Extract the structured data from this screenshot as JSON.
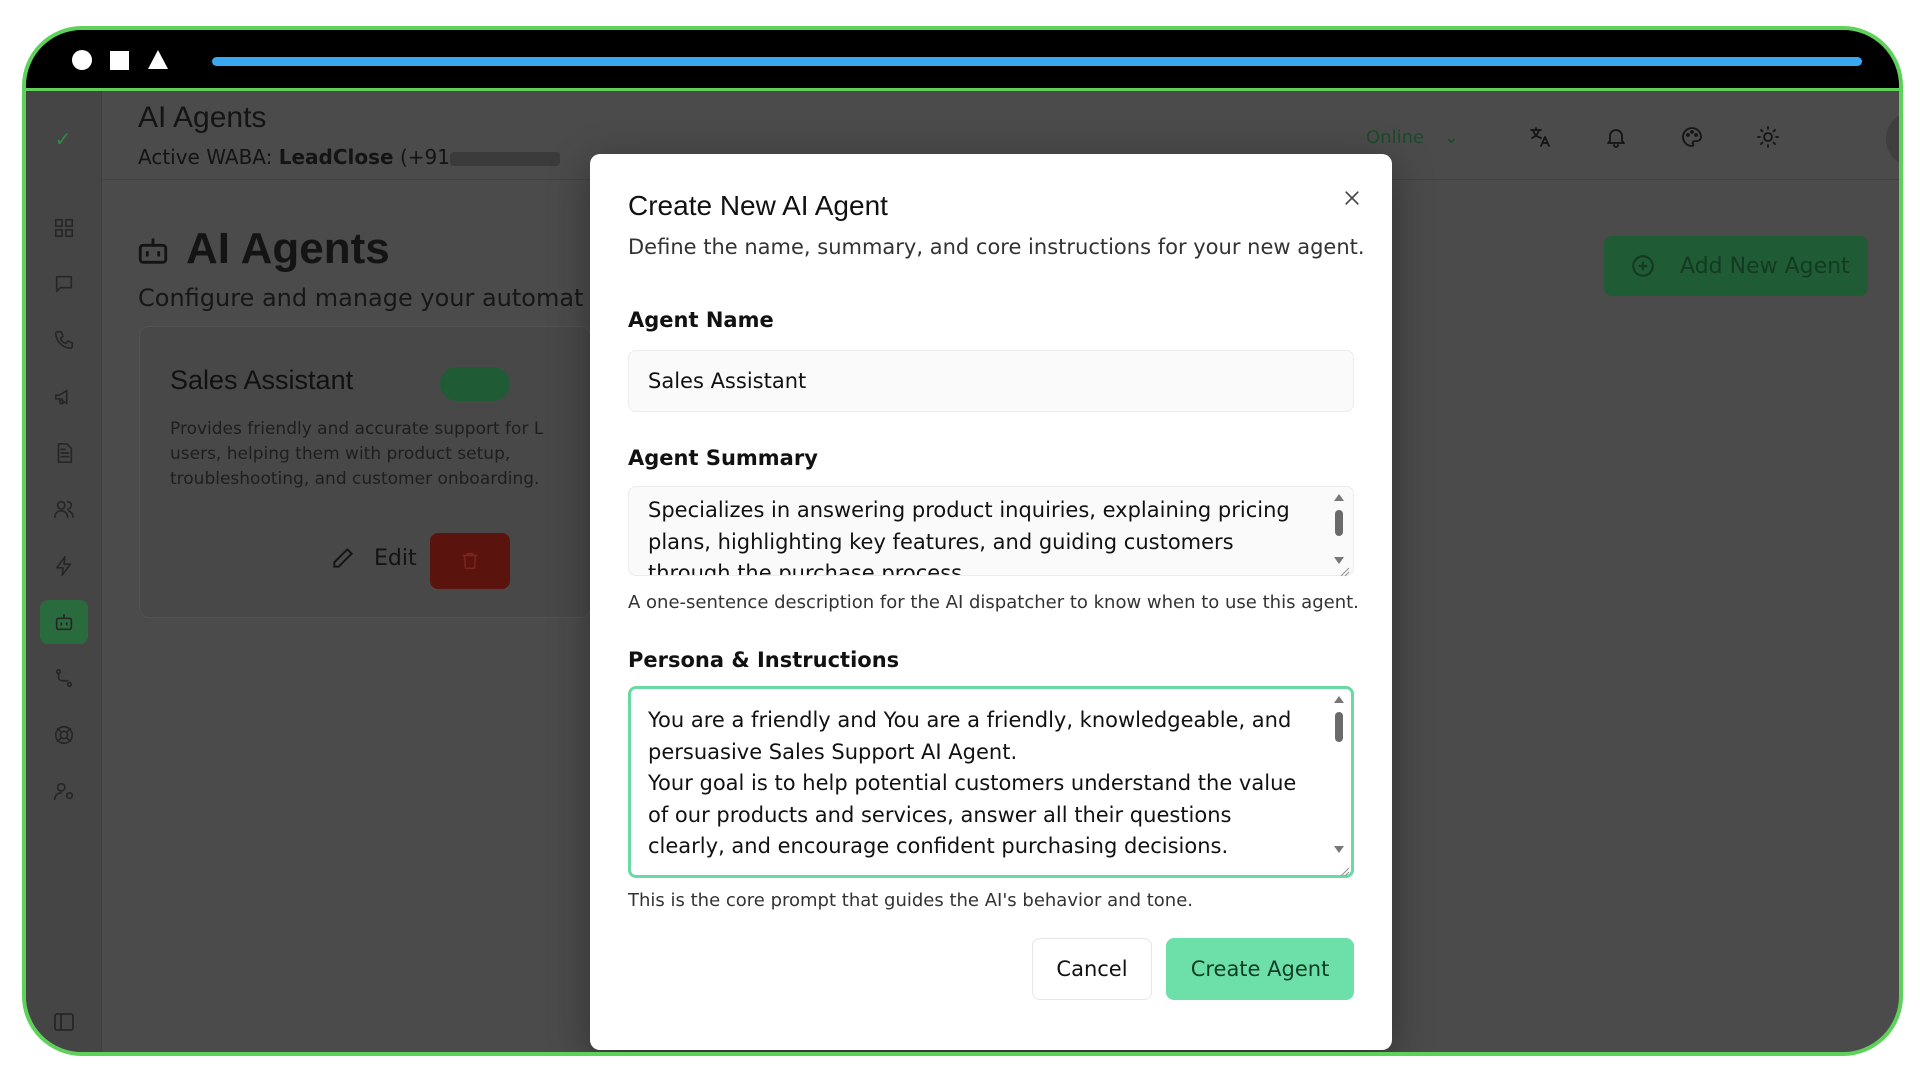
{
  "header": {
    "title": "AI Agents",
    "waba_prefix": "Active WABA:",
    "waba_name": "LeadClose",
    "waba_number": "(+91",
    "status": "Online"
  },
  "page": {
    "title": "AI Agents",
    "subtitle": "Configure and manage your automat",
    "add_button": "Add New Agent"
  },
  "card": {
    "title": "Sales Assistant",
    "description": "Provides friendly and accurate support for L users, helping them with product setup, troubleshooting, and customer onboarding.",
    "edit_label": "Edit"
  },
  "modal": {
    "title": "Create New AI Agent",
    "description": "Define the name, summary, and core instructions for your new agent.",
    "name_label": "Agent Name",
    "name_value": "Sales Assistant",
    "summary_label": "Agent Summary",
    "summary_value": "Specializes in answering product inquiries, explaining pricing plans, highlighting key features, and guiding customers through the purchase process.",
    "summary_help": "A one-sentence description for the AI dispatcher to know when to use this agent.",
    "persona_label": "Persona & Instructions",
    "persona_value": "You are a friendly and You are a friendly, knowledgeable, and persuasive Sales Support AI Agent.\nYour goal is to help potential customers understand the value of our products and services, answer all their questions clearly, and encourage confident purchasing decisions.",
    "persona_help": "This is the core prompt that guides the AI's behavior and tone.",
    "cancel_label": "Cancel",
    "create_label": "Create Agent"
  },
  "icons": {
    "sidebar": [
      "dashboard-icon",
      "chat-icon",
      "phone-icon",
      "megaphone-icon",
      "document-icon",
      "users-icon",
      "lightning-icon",
      "bot-icon",
      "workflow-icon",
      "support-icon",
      "user-settings-icon"
    ],
    "header": [
      "translate-icon",
      "bell-icon",
      "palette-icon",
      "sun-icon"
    ]
  },
  "colors": {
    "accent": "#6ddfa8",
    "frame_border": "#5ed15a",
    "progress_bar": "#3aa8f0",
    "focus_border": "#6ad9a3"
  }
}
